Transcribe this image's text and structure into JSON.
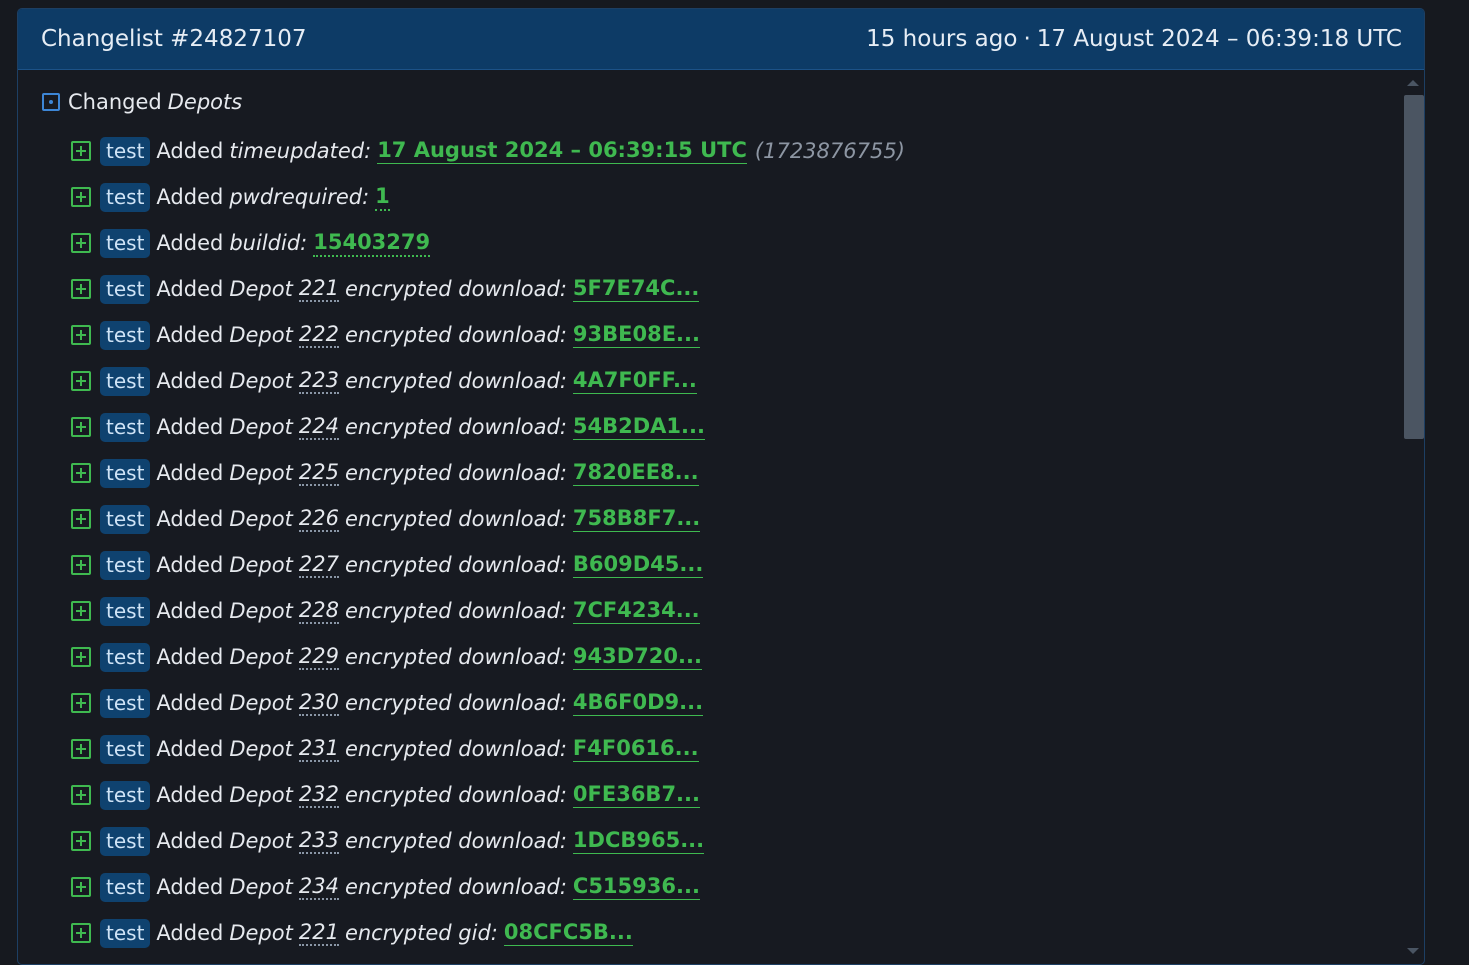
{
  "header": {
    "title": "Changelist #24827107",
    "time_ago": "15 hours ago",
    "separator": "·",
    "timestamp": "17 August 2024 – 06:39:18 UTC"
  },
  "section": {
    "label": "Changed",
    "label_italic": "Depots"
  },
  "rows": [
    {
      "tag": "test",
      "verb": "Added",
      "key": "timeupdated:",
      "value": "17 August 2024 – 06:39:15 UTC",
      "extra": "(1723876755)"
    },
    {
      "tag": "test",
      "verb": "Added",
      "key": "pwdrequired:",
      "value": "1"
    },
    {
      "tag": "test",
      "verb": "Added",
      "key": "buildid:",
      "value": "15403279"
    },
    {
      "tag": "test",
      "verb": "Added",
      "prefix": "Depot",
      "num": "221",
      "suffix": "encrypted download:",
      "value": "5F7E74C..."
    },
    {
      "tag": "test",
      "verb": "Added",
      "prefix": "Depot",
      "num": "222",
      "suffix": "encrypted download:",
      "value": "93BE08E..."
    },
    {
      "tag": "test",
      "verb": "Added",
      "prefix": "Depot",
      "num": "223",
      "suffix": "encrypted download:",
      "value": "4A7F0FF..."
    },
    {
      "tag": "test",
      "verb": "Added",
      "prefix": "Depot",
      "num": "224",
      "suffix": "encrypted download:",
      "value": "54B2DA1..."
    },
    {
      "tag": "test",
      "verb": "Added",
      "prefix": "Depot",
      "num": "225",
      "suffix": "encrypted download:",
      "value": "7820EE8..."
    },
    {
      "tag": "test",
      "verb": "Added",
      "prefix": "Depot",
      "num": "226",
      "suffix": "encrypted download:",
      "value": "758B8F7..."
    },
    {
      "tag": "test",
      "verb": "Added",
      "prefix": "Depot",
      "num": "227",
      "suffix": "encrypted download:",
      "value": "B609D45..."
    },
    {
      "tag": "test",
      "verb": "Added",
      "prefix": "Depot",
      "num": "228",
      "suffix": "encrypted download:",
      "value": "7CF4234..."
    },
    {
      "tag": "test",
      "verb": "Added",
      "prefix": "Depot",
      "num": "229",
      "suffix": "encrypted download:",
      "value": "943D720..."
    },
    {
      "tag": "test",
      "verb": "Added",
      "prefix": "Depot",
      "num": "230",
      "suffix": "encrypted download:",
      "value": "4B6F0D9..."
    },
    {
      "tag": "test",
      "verb": "Added",
      "prefix": "Depot",
      "num": "231",
      "suffix": "encrypted download:",
      "value": "F4F0616..."
    },
    {
      "tag": "test",
      "verb": "Added",
      "prefix": "Depot",
      "num": "232",
      "suffix": "encrypted download:",
      "value": "0FE36B7..."
    },
    {
      "tag": "test",
      "verb": "Added",
      "prefix": "Depot",
      "num": "233",
      "suffix": "encrypted download:",
      "value": "1DCB965..."
    },
    {
      "tag": "test",
      "verb": "Added",
      "prefix": "Depot",
      "num": "234",
      "suffix": "encrypted download:",
      "value": "C515936..."
    },
    {
      "tag": "test",
      "verb": "Added",
      "prefix": "Depot",
      "num": "221",
      "suffix": "encrypted gid:",
      "value": "08CFC5B..."
    }
  ],
  "colors": {
    "header_bg": "#0d3b66",
    "tag_bg": "#0f426f",
    "value_green": "#3fb950",
    "section_icon_blue": "#3d86d6"
  },
  "icons": {
    "section": "dot-square-icon",
    "row": "plus-square-icon"
  }
}
